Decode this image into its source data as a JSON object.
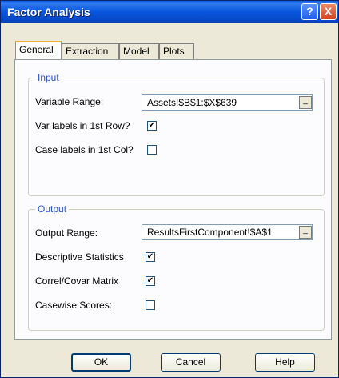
{
  "window": {
    "title": "Factor Analysis",
    "help_glyph": "?",
    "close_glyph": "X"
  },
  "tabs": [
    {
      "label": "General",
      "active": true
    },
    {
      "label": "Extraction",
      "active": false
    },
    {
      "label": "Model",
      "active": false
    },
    {
      "label": "Plots",
      "active": false
    }
  ],
  "input": {
    "legend": "Input",
    "variable_range_label": "Variable Range:",
    "variable_range_value": "Assets!$B$1:$X$639",
    "var_labels_label": "Var labels in 1st Row?",
    "var_labels_checked": true,
    "case_labels_label": "Case labels in 1st Col?",
    "case_labels_checked": false
  },
  "output": {
    "legend": "Output",
    "output_range_label": "Output Range:",
    "output_range_value": "ResultsFirstComponent!$A$1",
    "descriptive_label": "Descriptive Statistics",
    "descriptive_checked": true,
    "correl_label": "Correl/Covar Matrix",
    "correl_checked": true,
    "casewise_label": "Casewise Scores:",
    "casewise_checked": false
  },
  "buttons": {
    "ok": "OK",
    "cancel": "Cancel",
    "help": "Help"
  },
  "icons": {
    "range_picker": "_",
    "check_mark": "✔"
  }
}
